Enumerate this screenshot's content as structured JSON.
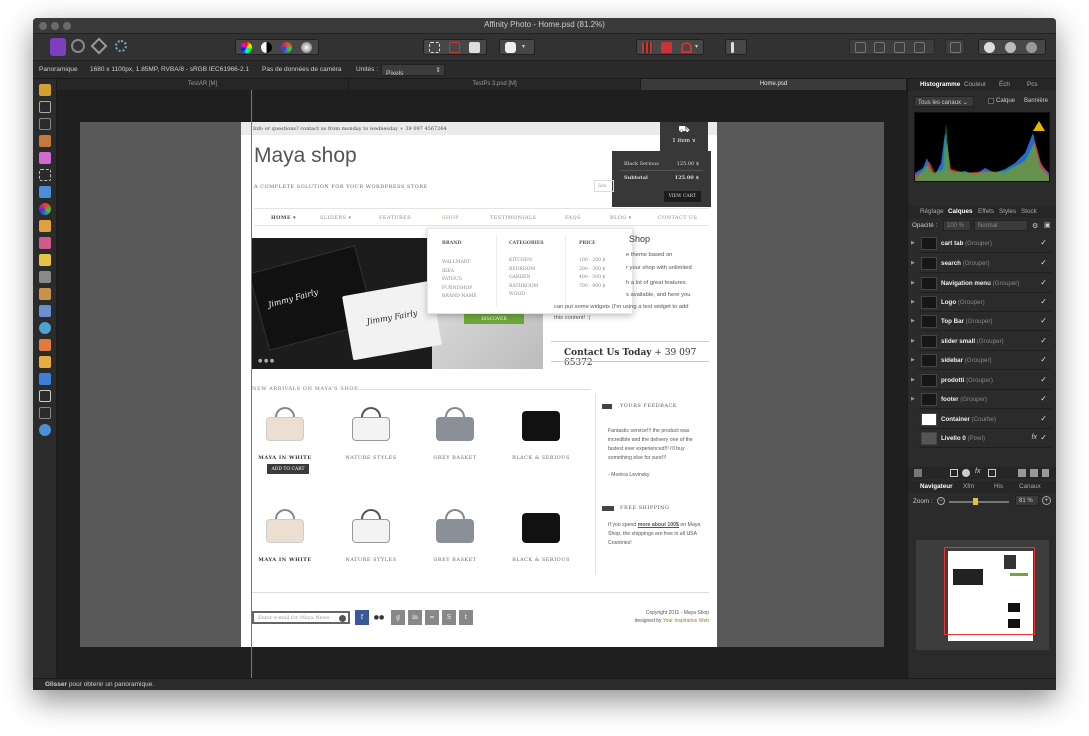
{
  "window": {
    "title": "Affinity Photo - Home.psd (81.2%)"
  },
  "context": {
    "persona": "Panoramique",
    "doc_info": "1680 x 1100px, 1.85MP, RVBA/8 - sRGB IEC61966-2.1",
    "camera": "Pas de données de caméra",
    "units_label": "Unités :",
    "units_value": "Pixels"
  },
  "tabs": [
    {
      "label": "TestAR [M]"
    },
    {
      "label": "TestPs 3.psd [M]"
    },
    {
      "label": "Home.psd"
    }
  ],
  "site": {
    "topbar": "Info or questions? contact us from monday to wednesday + 39 097 4567264",
    "logo": "Maya shop",
    "tagline": "A COMPLETE SOLUTION FOR YOUR WORDPRESS STORE",
    "nav": [
      "HOME ▾",
      "SLIDERS ▾",
      "FEATURES",
      "SHOP",
      "TESTIMONIALS",
      "FAQS",
      "BLOG ▾",
      "CONTACT US"
    ],
    "cart": {
      "items": "1 item ∨",
      "product": "Black Serious",
      "price": "125.00 $",
      "subtotal_label": "Subtotal",
      "subtotal": "125.00 $",
      "view": "VIEW CART"
    },
    "mega": {
      "brand_title": "BRAND",
      "brands": [
        "WALLMART",
        "IKEA",
        "FATHUS",
        "FURNISHOP",
        "BRAND NAME"
      ],
      "cat_title": "CATEGORIES",
      "cats": [
        "KITCHEN",
        "BEDROOM",
        "GARDEN",
        "BATHROOM",
        "WOOD"
      ],
      "price_title": "PRICE",
      "prices": [
        "100 - 200 $",
        "200 - 300 $",
        "400 - 500 $",
        "700 - 900 $"
      ]
    },
    "slider": {
      "brand": "Jimmy Fairly",
      "button": "DISCOVER"
    },
    "intro": {
      "title": "Shop",
      "lines": [
        "e theme based on",
        "r your shop with unlimited",
        "h a lot of great features.",
        "s available, and here you",
        "can put some widgets (I'm using a text widget to add",
        "this content! :)"
      ]
    },
    "contact": {
      "label": "Contact Us Today",
      "phone": "+ 39 097 65372"
    },
    "new_arrivals": "NEW ARRIVALS ON MAYA'S SHOP",
    "products_row1": [
      "MAYA IN WHITE",
      "NATURE STYLES",
      "GREY BASKET",
      "BLACK & SERIOUS"
    ],
    "products_row2": [
      "MAYA IN WHITE",
      "NATURE STYLES",
      "GREY BASKET",
      "BLACK & SERIOUS"
    ],
    "add_to_cart": "ADD TO CART",
    "feedback": {
      "title": "YOURS FEEDBACK",
      "text": "Fantastic service!!! the product was incredible and the delivery one of the fastest ever experienced!!! i'll buy something else for sure!!!",
      "author": "- Monica Levinsky"
    },
    "shipping": {
      "title": "FREE SHIPPING",
      "pre": "If you spend",
      "link": "more about 100$",
      "post": "on Maya Shop, the shippings are free in all USA Countries!"
    },
    "footer": {
      "email_placeholder": "Enter e-mail for Maya News",
      "copyright": "Copyright 2011 - Maya Shop",
      "designed": "designed by",
      "designer": "Your Inspiration Web"
    }
  },
  "panel": {
    "top_tabs": [
      "Histogramme",
      "Couleur",
      "Éch",
      "Pcs"
    ],
    "channels": "Tous les canaux ⌄",
    "layer_opt": "Calque",
    "banner": "Bannière",
    "layer_tabs": [
      "Réglage",
      "Calques",
      "Effets",
      "Styles",
      "Stock"
    ],
    "opacity_label": "Opacité :",
    "opacity_value": "100 %",
    "blend": "Normal",
    "layers": [
      {
        "name": "cart tab",
        "type": "(Grouper)"
      },
      {
        "name": "search",
        "type": "(Grouper)"
      },
      {
        "name": "Navigation menu",
        "type": "(Grouper)"
      },
      {
        "name": "Logo",
        "type": "(Grouper)"
      },
      {
        "name": "Top Bar",
        "type": "(Grouper)"
      },
      {
        "name": "slider small",
        "type": "(Grouper)"
      },
      {
        "name": "sidebar",
        "type": "(Grouper)"
      },
      {
        "name": "prodotti",
        "type": "(Grouper)"
      },
      {
        "name": "footer",
        "type": "(Grouper)"
      },
      {
        "name": "Container",
        "type": "(Courbe)"
      },
      {
        "name": "Livello 0",
        "type": "(Pixel)"
      }
    ],
    "nav_tabs": [
      "Navigateur",
      "Xfm",
      "His",
      "Canaux"
    ],
    "zoom_label": "Zoom :",
    "zoom_value": "81 %"
  },
  "status": {
    "bold": "Glisser",
    "text": "pour obtenir un panoramique."
  }
}
